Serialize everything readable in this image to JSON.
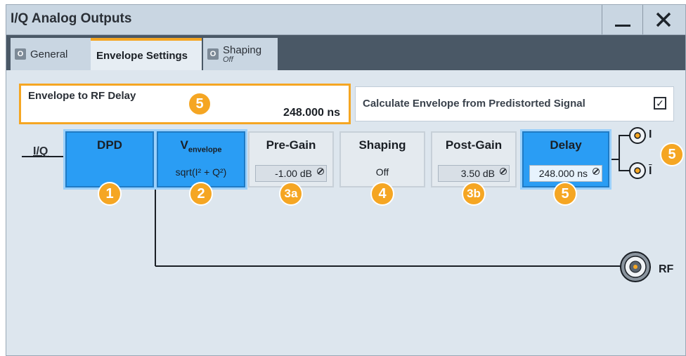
{
  "window": {
    "title": "I/Q Analog Outputs",
    "minimize_icon": "minimize-icon",
    "close_icon": "close-icon"
  },
  "tabs": [
    {
      "label": "General",
      "indicator": "O"
    },
    {
      "label": "Envelope Settings"
    },
    {
      "label": "Shaping",
      "indicator": "O",
      "sublabel": "Off"
    }
  ],
  "delay_field": {
    "label": "Envelope to RF Delay",
    "value": "248.000 ns",
    "badge": "5"
  },
  "calc_field": {
    "label": "Calculate Envelope from Predistorted Signal",
    "checked": true,
    "check_glyph": "✓"
  },
  "diagram": {
    "input_label": "I/Q",
    "blocks": [
      {
        "title": "DPD",
        "badge": "1"
      },
      {
        "title_main": "V",
        "title_sub": "envelope",
        "value": "sqrt(I² + Q²)",
        "badge": "2"
      },
      {
        "title": "Pre-Gain",
        "value": "-1.00 dB",
        "badge": "3a"
      },
      {
        "title": "Shaping",
        "value": "Off",
        "badge": "4"
      },
      {
        "title": "Post-Gain",
        "value": "3.50 dB",
        "badge": "3b"
      },
      {
        "title": "Delay",
        "value": "248.000 ns",
        "badge": "5"
      }
    ],
    "outputs": {
      "i_label": "I",
      "ibar_label": "I",
      "badge": "5",
      "rf_label": "RF"
    }
  },
  "colors": {
    "accent": "#f5a623",
    "active_block": "#2a9df4"
  }
}
